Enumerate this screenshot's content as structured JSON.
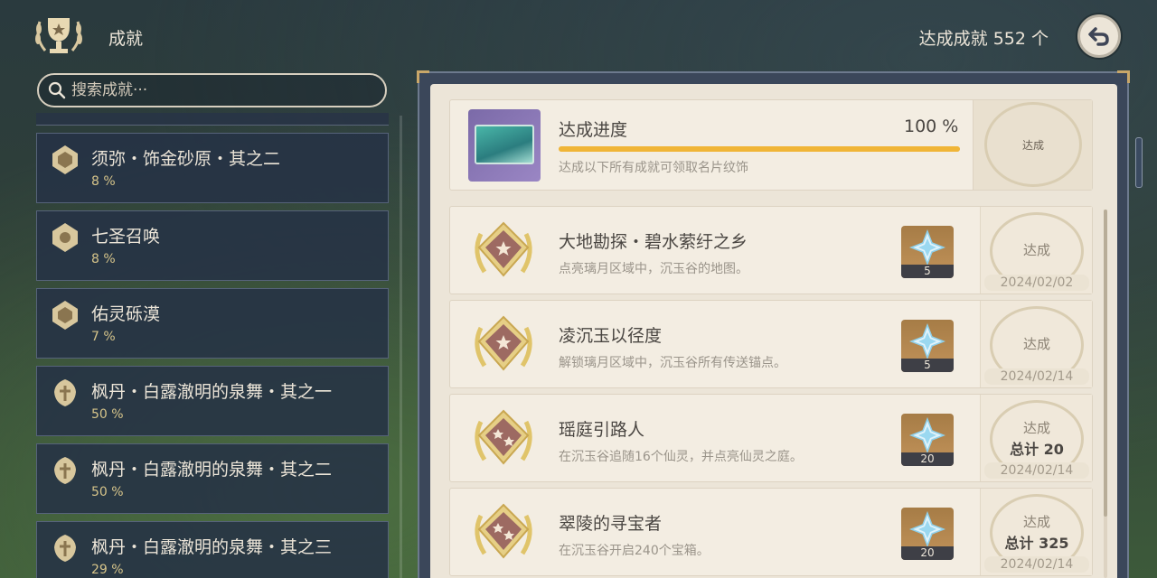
{
  "header": {
    "title": "成就",
    "total_label": "达成成就",
    "total_value": "552 个"
  },
  "search": {
    "placeholder": "搜索成就···"
  },
  "categories": [
    {
      "name": "须弥・饰金砂原・其之二",
      "percent": "8 %"
    },
    {
      "name": "七圣召唤",
      "percent": "8 %"
    },
    {
      "name": "佑灵砾漠",
      "percent": "7 %"
    },
    {
      "name": "枫丹・白露澈明的泉舞・其之一",
      "percent": "50 %"
    },
    {
      "name": "枫丹・白露澈明的泉舞・其之二",
      "percent": "50 %"
    },
    {
      "name": "枫丹・白露澈明的泉舞・其之三",
      "percent": "29 %"
    }
  ],
  "progress": {
    "title": "达成进度",
    "percent_label": "100 %",
    "fraction": 1.0,
    "description": "达成以下所有成就可领取名片纹饰",
    "stamp": "达成"
  },
  "achievements": [
    {
      "title": "大地勘探・碧水萦纡之乡",
      "description": "点亮璃月区域中，沉玉谷的地图。",
      "reward": "5",
      "status": "达成",
      "total": "",
      "date": "2024/02/02"
    },
    {
      "title": "凌沉玉以径度",
      "description": "解锁璃月区域中，沉玉谷所有传送锚点。",
      "reward": "5",
      "status": "达成",
      "total": "",
      "date": "2024/02/14"
    },
    {
      "title": "瑶庭引路人",
      "description": "在沉玉谷追随16个仙灵，并点亮仙灵之庭。",
      "reward": "20",
      "status": "达成",
      "total": "总计 20",
      "date": "2024/02/14"
    },
    {
      "title": "翠陵的寻宝者",
      "description": "在沉玉谷开启240个宝箱。",
      "reward": "20",
      "status": "达成",
      "total": "总计 325",
      "date": "2024/02/14"
    }
  ],
  "colors": {
    "accent_gold": "#f0b537",
    "panel_bg": "#ece5d8",
    "list_bg": "#263246"
  },
  "icons": {
    "logo": "trophy-wreath-icon",
    "back": "return-arrow-icon",
    "search": "search-icon",
    "reward": "primogem-icon",
    "medal": "achievement-medal-icon"
  }
}
